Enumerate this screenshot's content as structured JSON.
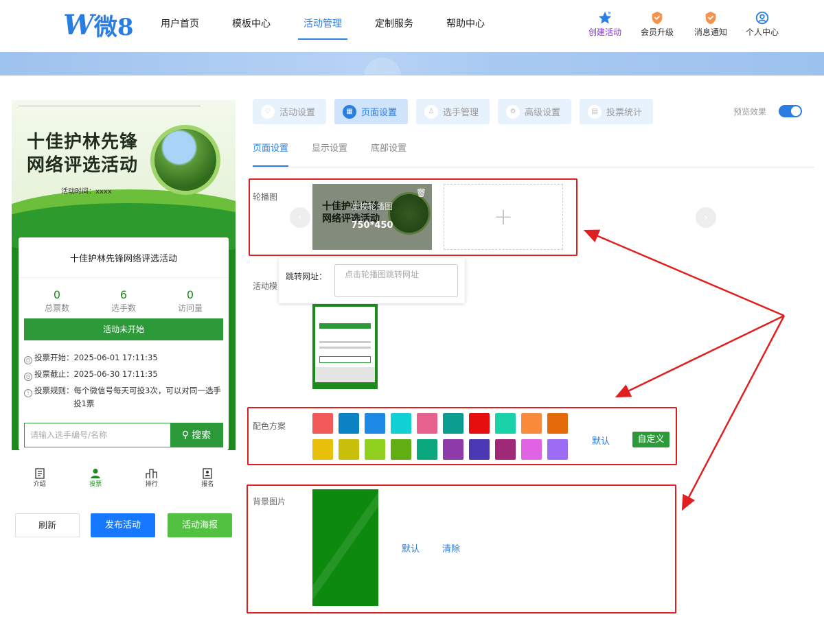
{
  "header": {
    "logo_mark": "W",
    "logo_text": "微8",
    "nav": [
      "用户首页",
      "模板中心",
      "活动管理",
      "定制服务",
      "帮助中心"
    ],
    "active_nav": "活动管理",
    "right": [
      {
        "label": "创建活动",
        "icon": "star-icon"
      },
      {
        "label": "会员升级",
        "icon": "shield-icon"
      },
      {
        "label": "消息通知",
        "icon": "bell-icon"
      },
      {
        "label": "个人中心",
        "icon": "user-icon"
      }
    ]
  },
  "phone": {
    "title_line1": "十佳护林先锋",
    "title_line2": "网络评选活动",
    "time_label": "活动时间：xxxx",
    "card_title": "十佳护林先锋网络评选活动",
    "stats": [
      {
        "value": "0",
        "label": "总票数"
      },
      {
        "value": "6",
        "label": "选手数"
      },
      {
        "value": "0",
        "label": "访问量"
      }
    ],
    "status_button": "活动未开始",
    "info": [
      {
        "icon": "clock-icon",
        "label": "投票开始：",
        "value": "2025-06-01 17:11:35"
      },
      {
        "icon": "clock-icon",
        "label": "投票截止：",
        "value": "2025-06-30 17:11:35"
      },
      {
        "icon": "info-icon",
        "label": "投票规则：",
        "value": "每个微信号每天可投3次，可以对同一选手",
        "value2": "投1票"
      }
    ],
    "search_placeholder": "请输入选手编号/名称",
    "search_button": "搜索",
    "tabs": [
      {
        "label": "介绍",
        "icon": "document-icon"
      },
      {
        "label": "投票",
        "icon": "person-icon"
      },
      {
        "label": "排行",
        "icon": "ranking-icon"
      },
      {
        "label": "报名",
        "icon": "signup-icon"
      }
    ],
    "active_tab": "投票"
  },
  "buttons": {
    "refresh": "刷新",
    "publish": "发布活动",
    "poster": "活动海报"
  },
  "steps": [
    {
      "label": "活动设置",
      "icon": "heart-icon"
    },
    {
      "label": "页面设置",
      "icon": "layout-icon"
    },
    {
      "label": "选手管理",
      "icon": "user-icon"
    },
    {
      "label": "高级设置",
      "icon": "settings-icon"
    },
    {
      "label": "投票统计",
      "icon": "chart-icon"
    }
  ],
  "active_step": "页面设置",
  "preview_label": "预览效果",
  "preview_enabled": true,
  "subtabs": [
    "页面设置",
    "显示设置",
    "底部设置"
  ],
  "active_subtab": "页面设置",
  "carousel": {
    "label": "轮播图",
    "thumb_title1": "十佳护林先锋",
    "thumb_title2": "网络评选活动",
    "thumb_label": "更换轮播图",
    "thumb_size": "750*450",
    "add_symbol": "+"
  },
  "jump": {
    "label": "跳转网址：",
    "placeholder": "点击轮播图跳转网址"
  },
  "template": {
    "label": "活动模"
  },
  "colors": {
    "label": "配色方案",
    "row1": [
      "#f25a5a",
      "#0a82c4",
      "#1e88e5",
      "#11d1d5",
      "#e8628f",
      "#0a9c8e",
      "#e50d0d",
      "#1ad2a8",
      "#fa8a3c",
      "#e56a0a"
    ],
    "row2": [
      "#e8c00c",
      "#c8bf0a",
      "#8fd11e",
      "#62ad12",
      "#0ca87d",
      "#8e3aa8",
      "#4b38b5",
      "#a02a77",
      "#e063e3",
      "#9c6cf4"
    ],
    "default_label": "默认",
    "custom_label": "自定义"
  },
  "background": {
    "label": "背景图片",
    "default_label": "默认",
    "clear_label": "清除"
  }
}
